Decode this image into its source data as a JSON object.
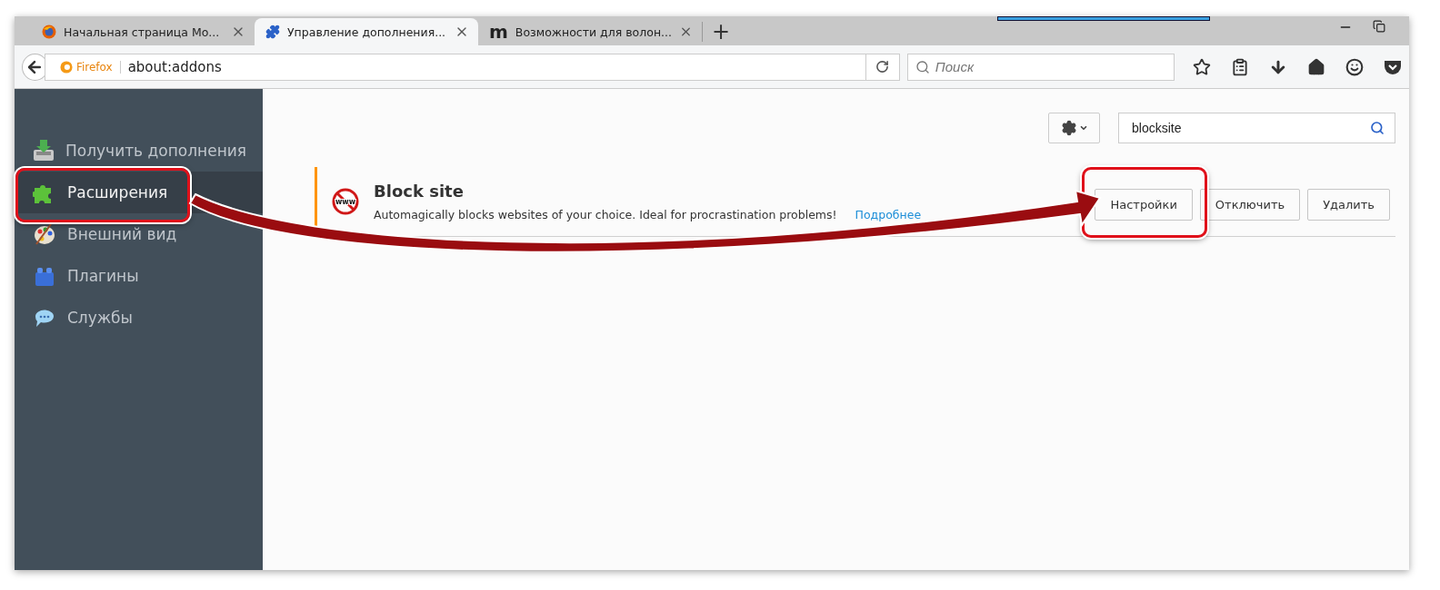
{
  "tabs": [
    {
      "title": "Начальная страница Mo...",
      "selected": false
    },
    {
      "title": "Управление дополнения...",
      "selected": true
    },
    {
      "title": "Возможности для волон...",
      "selected": false
    }
  ],
  "tab_icon_letter": "m",
  "new_tab": "+",
  "nav": {
    "identity": "Firefox",
    "url": "about:addons",
    "search_placeholder": "Поиск"
  },
  "sidebar": {
    "items": [
      {
        "label": "Получить дополнения",
        "selected": false,
        "highlighted": false
      },
      {
        "label": "Расширения",
        "selected": true,
        "highlighted": true
      },
      {
        "label": "Внешний вид",
        "selected": false,
        "highlighted": false
      },
      {
        "label": "Плагины",
        "selected": false,
        "highlighted": false
      },
      {
        "label": "Службы",
        "selected": false,
        "highlighted": false
      }
    ]
  },
  "search": {
    "value": "blocksite"
  },
  "addon": {
    "name": "Block site",
    "description": "Automagically blocks websites of your choice. Ideal for procrastination problems!",
    "more_link": "Подробнее",
    "icon_text": "www",
    "buttons": [
      {
        "label": "Настройки",
        "highlighted": true
      },
      {
        "label": "Отключить",
        "highlighted": false
      },
      {
        "label": "Удалить",
        "highlighted": false
      }
    ]
  }
}
